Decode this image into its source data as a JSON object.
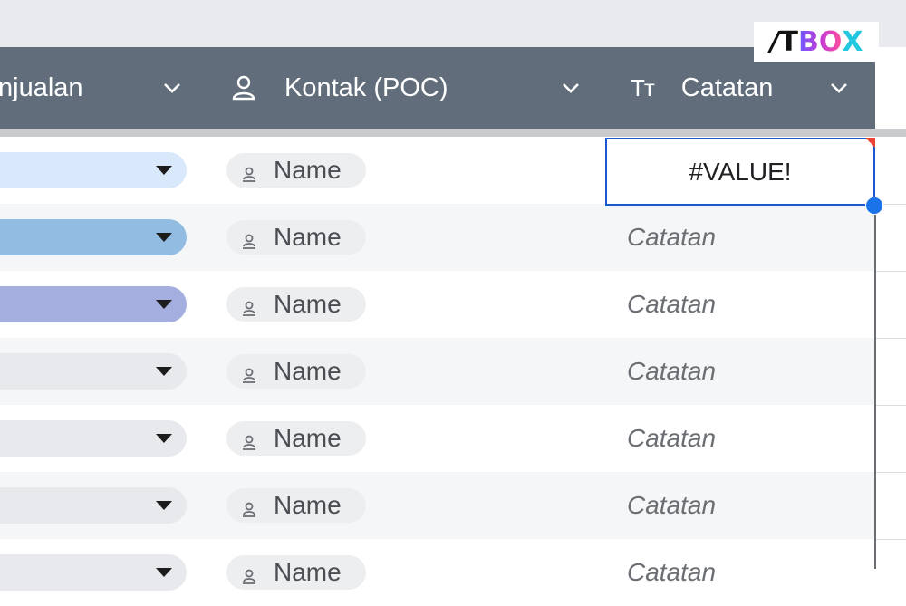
{
  "logo": {
    "part1": "/",
    "part2": "T",
    "part3": "BO",
    "part4": "X"
  },
  "header": {
    "col_sales_partial": "njualan",
    "col_contact": "Kontak (POC)",
    "col_contact_icon": "person-icon",
    "col_notes": "Catatan",
    "col_notes_icon": "text-type-icon",
    "type_icon_text": "Tт"
  },
  "selected_cell": {
    "value": "#VALUE!"
  },
  "rows": [
    {
      "pill_color": "#d9e9fb",
      "contact": "Name",
      "note": ""
    },
    {
      "pill_color": "#93bce2",
      "contact": "Name",
      "note": "Catatan"
    },
    {
      "pill_color": "#a4afdf",
      "contact": "Name",
      "note": "Catatan"
    },
    {
      "pill_color": "#e8e9ec",
      "contact": "Name",
      "note": "Catatan"
    },
    {
      "pill_color": "#e8e9ec",
      "contact": "Name",
      "note": "Catatan"
    },
    {
      "pill_color": "#e8e9ec",
      "contact": "Name",
      "note": "Catatan"
    },
    {
      "pill_color": "#e8e9ec",
      "contact": "Name",
      "note": "Catatan"
    }
  ],
  "colors": {
    "header_bg": "#616d7a",
    "selection_border": "#1a57d0",
    "fill_handle": "#1a73e8",
    "error_flag": "#ea4335"
  }
}
